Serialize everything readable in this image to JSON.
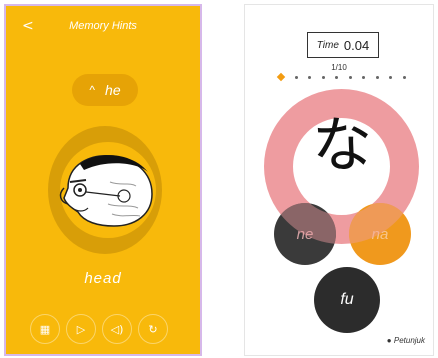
{
  "left": {
    "back_glyph": "<",
    "title": "Memory Hints",
    "hint": {
      "caret": "^",
      "text": "he"
    },
    "word": "head",
    "controls": [
      {
        "name": "grid-icon",
        "glyph": "▦"
      },
      {
        "name": "play-icon",
        "glyph": "▷"
      },
      {
        "name": "speaker-icon",
        "glyph": "◁)"
      },
      {
        "name": "refresh-icon",
        "glyph": "↻"
      }
    ]
  },
  "right": {
    "timer_label": "Time",
    "timer_value": "0.04",
    "progress": "1/10",
    "question_kana": "な",
    "options": [
      "ne",
      "na",
      "fu"
    ],
    "footer": "Petunjuk"
  },
  "colors": {
    "left_bg": "#f8b90b",
    "ring": "#ee9ca0",
    "option_dark": "#2c2c2c",
    "option_orange": "#f0991d"
  }
}
